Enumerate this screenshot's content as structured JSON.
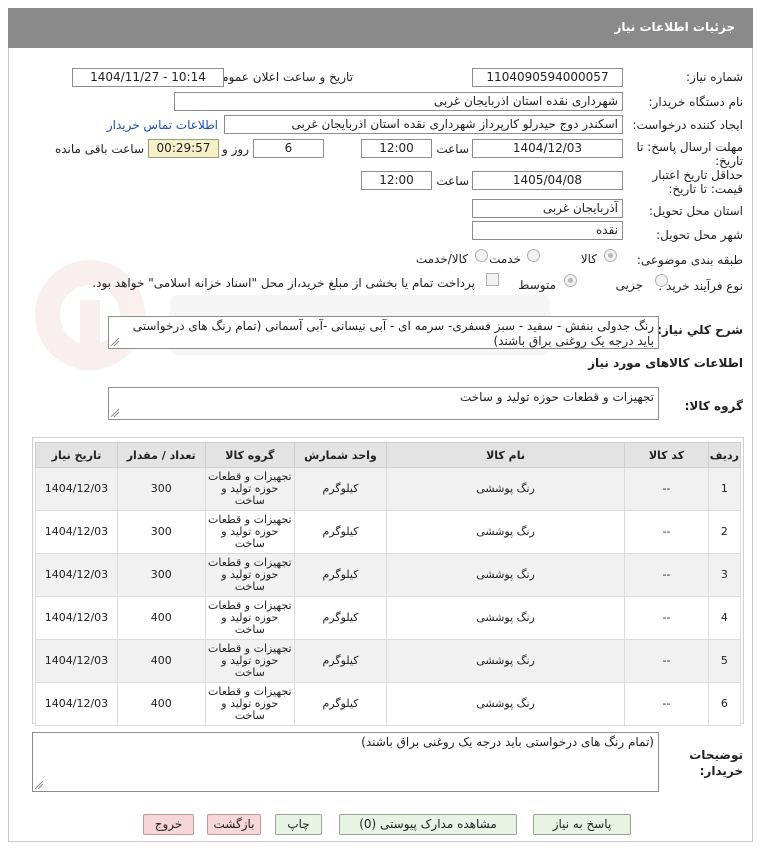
{
  "header": {
    "title": "جزئیات اطلاعات نیاز"
  },
  "form": {
    "need_number_label": "شماره نیاز:",
    "need_number": "1104090594000057",
    "announce_label": "تاریخ و ساعت اعلان عمومی:",
    "announce_value": "1404/11/27 - 10:14",
    "buyer_label": "نام دستگاه خریدار:",
    "buyer_value": "شهرداری نقده استان اذربایجان غربی",
    "creator_label": "ایجاد کننده درخواست:",
    "creator_value": "اسکندر دوج حیدرلو کارپرداز شهرداری نقده استان اذربایجان غربی",
    "contact_link": "اطلاعات تماس خریدار",
    "send_deadline_label_1": "مهلت ارسال پاسخ: تا",
    "send_deadline_label_2": "تاریخ:",
    "send_date": "1404/12/03",
    "time_label": "ساعت",
    "send_time": "12:00",
    "days_value": "6",
    "days_label": "روز و",
    "timer_value": "00:29:57",
    "remaining_label": "ساعت باقی مانده",
    "validity_label_1": "حداقل تاریخ اعتبار",
    "validity_label_2": "قیمت: تا تاریخ:",
    "validity_date": "1405/04/08",
    "validity_time": "12:00",
    "province_label": "استان محل تحویل:",
    "province_value": "آذربایجان غربی",
    "city_label": "شهر محل تحویل:",
    "city_value": "نقده",
    "category_label": "طبقه بندی موضوعی:",
    "category_options": [
      "کالا",
      "خدمت",
      "کالا/خدمت"
    ],
    "process_label": "نوع فرآیند خرید :",
    "process_options": [
      "جزیی",
      "متوسط"
    ],
    "payment_note": "پرداخت تمام یا بخشی از مبلغ خرید،از محل \"اسناد خزانه اسلامی\" خواهد بود."
  },
  "description": {
    "label": "شرح کلي نياز:",
    "text": "رنگ جدولی بنفش - سفید - سبز فسفری- سرمه ای - آبی نیسانی -آبی آسمانی (تمام رنگ های درخواستی باید درجه یک روغنی براق باشند)"
  },
  "goods_section_title": "اطلاعات کالاهای مورد نیاز",
  "goods_group": {
    "label": "گروه کالا:",
    "value": "تجهیزات و قطعات حوزه تولید و ساخت"
  },
  "table": {
    "headers": [
      "ردیف",
      "کد کالا",
      "نام کالا",
      "واحد شمارش",
      "گروه کالا",
      "تعداد / مقدار",
      "تاریخ نیاز"
    ],
    "rows": [
      [
        "1",
        "--",
        "رنگ پوششی",
        "کیلوگرم",
        "تجهیزات و قطعات حوزه تولید و ساخت",
        "300",
        "1404/12/03"
      ],
      [
        "2",
        "--",
        "رنگ پوششی",
        "کیلوگرم",
        "تجهیزات و قطعات حوزه تولید و ساخت",
        "300",
        "1404/12/03"
      ],
      [
        "3",
        "--",
        "رنگ پوششی",
        "کیلوگرم",
        "تجهیزات و قطعات حوزه تولید و ساخت",
        "300",
        "1404/12/03"
      ],
      [
        "4",
        "--",
        "رنگ پوششی",
        "کیلوگرم",
        "تجهیزات و قطعات حوزه تولید و ساخت",
        "400",
        "1404/12/03"
      ],
      [
        "5",
        "--",
        "رنگ پوششی",
        "کیلوگرم",
        "تجهیزات و قطعات حوزه تولید و ساخت",
        "400",
        "1404/12/03"
      ],
      [
        "6",
        "--",
        "رنگ پوششی",
        "کیلوگرم",
        "تجهیزات و قطعات حوزه تولید و ساخت",
        "400",
        "1404/12/03"
      ]
    ]
  },
  "buyer_notes": {
    "label_1": "توضیحات",
    "label_2": "خریدار:",
    "text": "(تمام رنگ های درخواستی باید درجه یک روغنی براق باشند)"
  },
  "buttons": {
    "reply": "پاسخ به نیاز",
    "attachments": "مشاهده مدارک پیوستی (0)",
    "print": "چاپ",
    "back": "بازگشت",
    "exit": "خروج"
  },
  "colors": {
    "header_bg": "#8a8a8a",
    "timer_bg": "#f5f0c8",
    "button_green": "#e9f3e4",
    "button_red": "#f6d6d6",
    "link": "#1a4fb8"
  }
}
